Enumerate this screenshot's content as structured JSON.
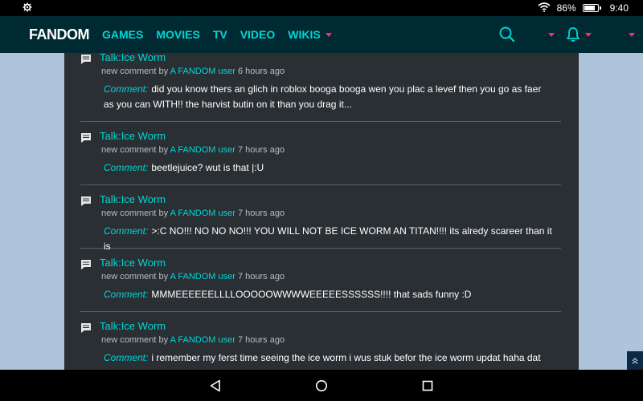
{
  "status_bar": {
    "battery": "86%",
    "time": "9:40",
    "battery_level": 86
  },
  "nav": {
    "logo": "FANDOM",
    "items": [
      {
        "label": "GAMES"
      },
      {
        "label": "MOVIES"
      },
      {
        "label": "TV"
      },
      {
        "label": "VIDEO"
      },
      {
        "label": "WIKIS"
      }
    ]
  },
  "colors": {
    "accent": "#00d6d6",
    "caret": "#ff2b6b",
    "nav_bg": "#002a32",
    "content_bg": "#2a2f33"
  },
  "feed": [
    {
      "title": "Talk:Ice Worm",
      "meta_prefix": "new comment by",
      "user": "A FANDOM user",
      "time": "6 hours ago",
      "comment_label": "Comment:",
      "comment": "did you know thers an glich in roblox booga booga wen you plac a levef then you go as faer as you can WITH!! the harvist butin on it than you drag it..."
    },
    {
      "title": "Talk:Ice Worm",
      "meta_prefix": "new comment by",
      "user": "A FANDOM user",
      "time": "7 hours ago",
      "comment_label": "Comment:",
      "comment": "beetlejuice? wut is that |:U"
    },
    {
      "title": "Talk:Ice Worm",
      "meta_prefix": "new comment by",
      "user": "A FANDOM user",
      "time": "7 hours ago",
      "comment_label": "Comment:",
      "comment": ">:C NO!!! NO NO NO!!! YOU WILL NOT BE ICE WORM AN TITAN!!!! its alredy scareer than it is"
    },
    {
      "title": "Talk:Ice Worm",
      "meta_prefix": "new comment by",
      "user": "A FANDOM user",
      "time": "7 hours ago",
      "comment_label": "Comment:",
      "comment": "MMMEEEEEELLLLOOOOOWWWWEEEEESSSSSS!!!! that sads funny :D"
    },
    {
      "title": "Talk:Ice Worm",
      "meta_prefix": "new comment by",
      "user": "A FANDOM user",
      "time": "7 hours ago",
      "comment_label": "Comment:",
      "comment": "i remember my ferst time seeing the ice worm i wus stuk befor the ice  worm updat haha dat up"
    }
  ],
  "icons": {
    "settings": "gear-icon",
    "wifi": "wifi-icon",
    "battery": "battery-icon",
    "search": "search-icon",
    "notifications": "bell-icon",
    "page": "page-comment-icon",
    "back": "back-triangle-icon",
    "home": "home-circle-icon",
    "recents": "recents-square-icon",
    "scroll_top": "double-chevron-up-icon"
  }
}
